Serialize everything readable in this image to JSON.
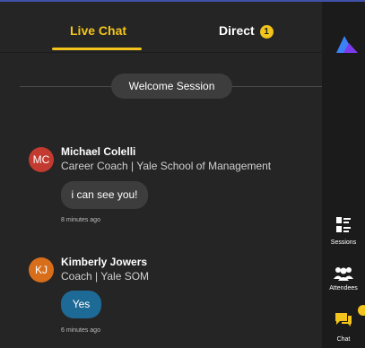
{
  "tabs": {
    "live_chat": "Live Chat",
    "direct": "Direct",
    "direct_badge": "1"
  },
  "session": {
    "label": "Welcome Session"
  },
  "messages": [
    {
      "initials": "MC",
      "name": "Michael Colelli",
      "title": "Career Coach | Yale School of Management",
      "text": "i can see you!",
      "time": "8 minutes ago",
      "avatar_color": "#c23a30",
      "bubble_color": "#3d3d3d"
    },
    {
      "initials": "KJ",
      "name": "Kimberly Jowers",
      "title": "Coach | Yale SOM",
      "text": "Yes",
      "time": "6 minutes ago",
      "avatar_color": "#d96e1a",
      "bubble_color": "#1e6a96"
    }
  ],
  "sidebar": {
    "items": [
      {
        "label": "Sessions",
        "icon": "sessions-icon"
      },
      {
        "label": "Attendees",
        "icon": "attendees-icon"
      },
      {
        "label": "Chat",
        "icon": "chat-icon"
      }
    ]
  },
  "colors": {
    "accent": "#f3c41b",
    "background": "#252525",
    "sidebar": "#1b1b1b"
  }
}
